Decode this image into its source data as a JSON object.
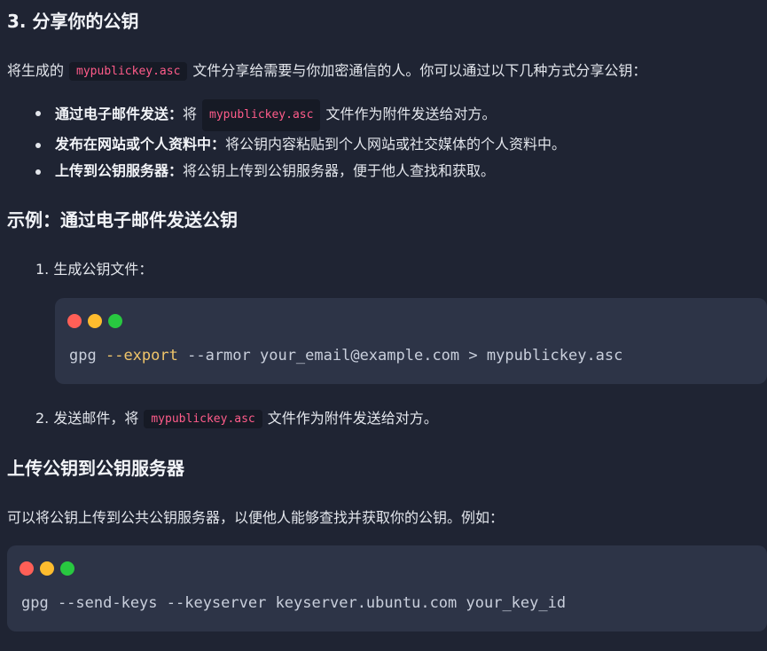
{
  "section3": {
    "heading": "3. 分享你的公钥",
    "intro_before": "将生成的",
    "intro_code": "mypublickey.asc",
    "intro_after": "文件分享给需要与你加密通信的人。你可以通过以下几种方式分享公钥：",
    "bullets": [
      {
        "bold": "通过电子邮件发送：",
        "before": "将",
        "code": "mypublickey.asc",
        "after": "文件作为附件发送给对方。"
      },
      {
        "bold": "发布在网站或个人资料中：",
        "text": "将公钥内容粘贴到个人网站或社交媒体的个人资料中。"
      },
      {
        "bold": "上传到公钥服务器：",
        "text": "将公钥上传到公钥服务器，便于他人查找和获取。"
      }
    ]
  },
  "example": {
    "heading": "示例：通过电子邮件发送公钥",
    "step1": "1. 生成公钥文件：",
    "code1": {
      "cmd": "gpg",
      "keyword": "--export",
      "rest": "--armor your_email@example.com > mypublickey.asc"
    },
    "step2_before": "2. 发送邮件，将",
    "step2_code": "mypublickey.asc",
    "step2_after": "文件作为附件发送给对方。"
  },
  "upload": {
    "heading": "上传公钥到公钥服务器",
    "text": "可以将公钥上传到公共公钥服务器，以便他人能够查找并获取你的公钥。例如：",
    "code": "gpg --send-keys --keyserver keyserver.ubuntu.com your_key_id"
  },
  "colors": {
    "background": "#1f2433",
    "code_block": "#2d3447",
    "inline_code_text": "#ff5c8a",
    "keyword": "#f0c56a",
    "dot_red": "#ff5f57",
    "dot_yellow": "#febc2e",
    "dot_green": "#28c840"
  }
}
